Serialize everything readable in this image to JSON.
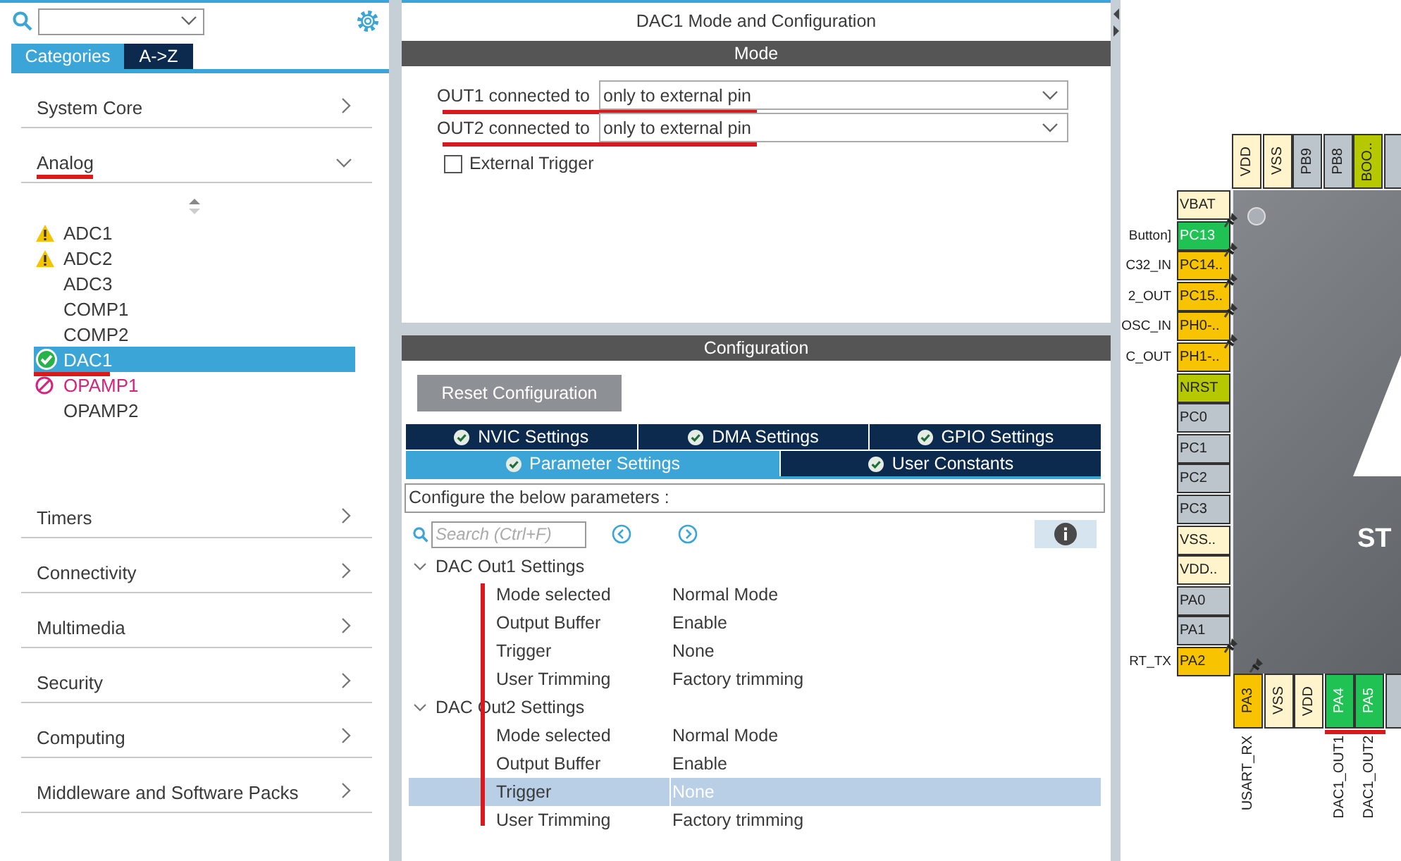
{
  "left_panel": {
    "tabs": [
      {
        "label": "Categories",
        "selected": true
      },
      {
        "label": "A->Z",
        "selected": false
      }
    ],
    "categories": [
      {
        "label": "System Core",
        "expanded": false
      },
      {
        "label": "Analog",
        "expanded": true,
        "underlined": true,
        "children": [
          {
            "label": "ADC1",
            "kind": "warning",
            "selected": false,
            "underlined": false
          },
          {
            "label": "ADC2",
            "kind": "warning",
            "selected": false,
            "underlined": false
          },
          {
            "label": "ADC3",
            "kind": "plain",
            "selected": false,
            "underlined": false
          },
          {
            "label": "COMP1",
            "kind": "plain",
            "selected": false,
            "underlined": false
          },
          {
            "label": "COMP2",
            "kind": "plain",
            "selected": false,
            "underlined": false
          },
          {
            "label": "DAC1",
            "kind": "ok",
            "selected": true,
            "underlined": true
          },
          {
            "label": "OPAMP1",
            "kind": "blocked",
            "selected": false,
            "underlined": false
          },
          {
            "label": "OPAMP2",
            "kind": "plain",
            "selected": false,
            "underlined": false
          }
        ]
      },
      {
        "label": "Timers",
        "expanded": false
      },
      {
        "label": "Connectivity",
        "expanded": false
      },
      {
        "label": "Multimedia",
        "expanded": false
      },
      {
        "label": "Security",
        "expanded": false
      },
      {
        "label": "Computing",
        "expanded": false
      },
      {
        "label": "Middleware and Software Packs",
        "expanded": false
      }
    ]
  },
  "mode_panel": {
    "title": "DAC1 Mode and Configuration",
    "header": "Mode",
    "outputs": [
      {
        "label": "OUT1 connected to",
        "value": "only to external pin",
        "underlined": true
      },
      {
        "label": "OUT2 connected to",
        "value": "only to external pin",
        "underlined": true
      }
    ],
    "external_trigger": {
      "label": "External Trigger",
      "checked": false
    }
  },
  "config_panel": {
    "header": "Configuration",
    "reset_button": "Reset Configuration",
    "tab_rows": [
      [
        {
          "label": "NVIC Settings",
          "selected": false
        },
        {
          "label": "DMA Settings",
          "selected": false
        },
        {
          "label": "GPIO Settings",
          "selected": false
        }
      ],
      [
        {
          "label": "Parameter Settings",
          "selected": true
        },
        {
          "label": "User Constants",
          "selected": false
        }
      ]
    ],
    "hint": "Configure the below parameters :",
    "search": {
      "placeholder": "Search (Ctrl+F)"
    },
    "groups": [
      {
        "label": "DAC Out1 Settings",
        "expanded": true,
        "children": [
          {
            "name": "Mode selected",
            "value": "Normal Mode",
            "selected": false
          },
          {
            "name": "Output Buffer",
            "value": "Enable",
            "selected": false
          },
          {
            "name": "Trigger",
            "value": "None",
            "selected": false
          },
          {
            "name": "User Trimming",
            "value": "Factory trimming",
            "selected": false
          }
        ]
      },
      {
        "label": "DAC Out2 Settings",
        "expanded": true,
        "children": [
          {
            "name": "Mode selected",
            "value": "Normal Mode",
            "selected": false
          },
          {
            "name": "Output Buffer",
            "value": "Enable",
            "selected": false
          },
          {
            "name": "Trigger",
            "value": "None",
            "selected": true
          },
          {
            "name": "User Trimming",
            "value": "Factory trimming",
            "selected": false
          }
        ]
      }
    ]
  },
  "pinout": {
    "chip_text": "ST",
    "top_pins": [
      {
        "label": "VDD",
        "color": "#fff4cc"
      },
      {
        "label": "VSS",
        "color": "#fff4cc"
      },
      {
        "label": "PB9",
        "color": "#bcc4cc"
      },
      {
        "label": "PB8",
        "color": "#bcc4cc"
      },
      {
        "label": "BOO..",
        "color": "#b6c900"
      },
      {
        "color": "#bcc4cc"
      }
    ],
    "left_pins": [
      {
        "label": "VBAT",
        "color": "#fff4cc",
        "pinned": false
      },
      {
        "label": "PC13",
        "color": "#1fc253",
        "pinned": true,
        "signal": "Button]"
      },
      {
        "label": "PC14..",
        "color": "#f8c300",
        "pinned": true,
        "signal": "C32_IN"
      },
      {
        "label": "PC15..",
        "color": "#f8c300",
        "pinned": true,
        "signal": "2_OUT"
      },
      {
        "label": "PH0-..",
        "color": "#f8c300",
        "pinned": true,
        "signal": "OSC_IN"
      },
      {
        "label": "PH1-..",
        "color": "#f8c300",
        "pinned": true,
        "signal": "C_OUT"
      },
      {
        "label": "NRST",
        "color": "#b6c900",
        "pinned": false
      },
      {
        "label": "PC0",
        "color": "#bcc4cc",
        "pinned": false
      },
      {
        "label": "PC1",
        "color": "#bcc4cc",
        "pinned": false
      },
      {
        "label": "PC2",
        "color": "#bcc4cc",
        "pinned": false
      },
      {
        "label": "PC3",
        "color": "#bcc4cc",
        "pinned": false
      },
      {
        "label": "VSS..",
        "color": "#fff4cc",
        "pinned": false
      },
      {
        "label": "VDD..",
        "color": "#fff4cc",
        "pinned": false
      },
      {
        "label": "PA0",
        "color": "#bcc4cc",
        "pinned": false
      },
      {
        "label": "PA1",
        "color": "#bcc4cc",
        "pinned": false
      },
      {
        "label": "PA2",
        "color": "#f8c300",
        "pinned": true,
        "signal": "RT_TX"
      }
    ],
    "bottom_pins": [
      {
        "label": "PA3",
        "color": "#f8c300",
        "pinned": true,
        "signal": "USART_RX",
        "underlined": false
      },
      {
        "label": "VSS",
        "color": "#fff4cc",
        "pinned": false,
        "underlined": false
      },
      {
        "label": "VDD",
        "color": "#fff4cc",
        "pinned": false,
        "underlined": false
      },
      {
        "label": "PA4",
        "color": "#1fc253",
        "pinned": false,
        "signal": "DAC1_OUT1",
        "underlined": true
      },
      {
        "label": "PA5",
        "color": "#1fc253",
        "pinned": false,
        "signal": "DAC1_OUT2",
        "underlined": true
      },
      {
        "color": "#bcc4cc",
        "pinned": false,
        "underlined": false
      }
    ]
  }
}
